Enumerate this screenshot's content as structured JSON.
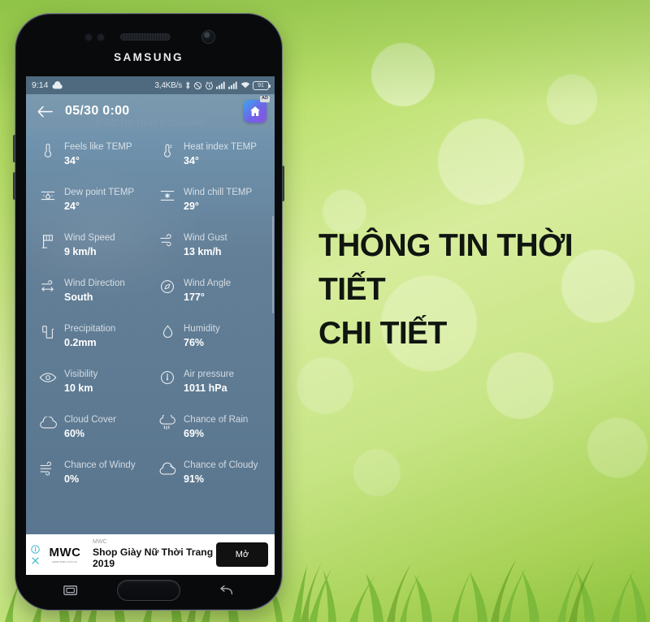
{
  "marketing": {
    "headline": "THÔNG TIN THỜI TIẾT\nCHI TIẾT"
  },
  "phone": {
    "brand": "SAMSUNG",
    "nav": {
      "recents_label": "recents-key",
      "home_label": "home-key",
      "back_label": "back-key"
    }
  },
  "status_bar": {
    "time": "9:14",
    "weather_icon": "cloud-icon",
    "network_speed": "3,4KB/s",
    "icons": [
      "bluetooth-icon",
      "vibrate-icon",
      "alarm-icon",
      "signal-icon",
      "signal-icon",
      "wifi-icon"
    ],
    "battery_level": "91"
  },
  "app_bar": {
    "back_icon": "back-arrow-icon",
    "title": "05/30 0:00",
    "ad_icon": "home-app-icon",
    "ad_badge": "AD"
  },
  "condition_peek": "Patchy rain possible",
  "details": {
    "rows": [
      [
        {
          "icon": "thermometer-icon",
          "label": "Feels like TEMP",
          "value": "34°"
        },
        {
          "icon": "thermometer-heat-icon",
          "label": "Heat index TEMP",
          "value": "34°"
        }
      ],
      [
        {
          "icon": "dew-point-icon",
          "label": "Dew point TEMP",
          "value": "24°"
        },
        {
          "icon": "snowflake-icon",
          "label": "Wind chill TEMP",
          "value": "29°"
        }
      ],
      [
        {
          "icon": "wind-flag-icon",
          "label": "Wind Speed",
          "value": "9 km/h"
        },
        {
          "icon": "wind-gust-icon",
          "label": "Wind Gust",
          "value": "13 km/h"
        }
      ],
      [
        {
          "icon": "wind-direction-icon",
          "label": "Wind Direction",
          "value": "South"
        },
        {
          "icon": "compass-icon",
          "label": "Wind Angle",
          "value": "177°"
        }
      ],
      [
        {
          "icon": "precipitation-icon",
          "label": "Precipitation",
          "value": "0.2mm"
        },
        {
          "icon": "droplet-icon",
          "label": "Humidity",
          "value": "76%"
        }
      ],
      [
        {
          "icon": "eye-icon",
          "label": "Visibility",
          "value": "10 km"
        },
        {
          "icon": "barometer-icon",
          "label": "Air pressure",
          "value": "1011 hPa"
        }
      ],
      [
        {
          "icon": "cloud-icon",
          "label": "Cloud Cover",
          "value": "60%"
        },
        {
          "icon": "rain-cloud-icon",
          "label": "Chance of Rain",
          "value": "69%"
        }
      ],
      [
        {
          "icon": "windy-icon",
          "label": "Chance of Windy",
          "value": "0%"
        },
        {
          "icon": "partly-cloudy-icon",
          "label": "Chance of Cloudy",
          "value": "91%"
        }
      ]
    ]
  },
  "ad_banner": {
    "info_icon": "info-icon",
    "close_icon": "close-icon",
    "logo_text": "MWC",
    "logo_url": "www.mwc.com.vn",
    "advertiser": "MWC",
    "title": "Shop Giày Nữ Thời Trang 2019",
    "cta_label": "Mở"
  },
  "colors": {
    "app_bg_top": "#7e9db5",
    "app_bg_bottom": "#5a7690",
    "status_bar": "#4f6a7e",
    "accent_green": "#9fd14e",
    "cta_black": "#111111"
  }
}
